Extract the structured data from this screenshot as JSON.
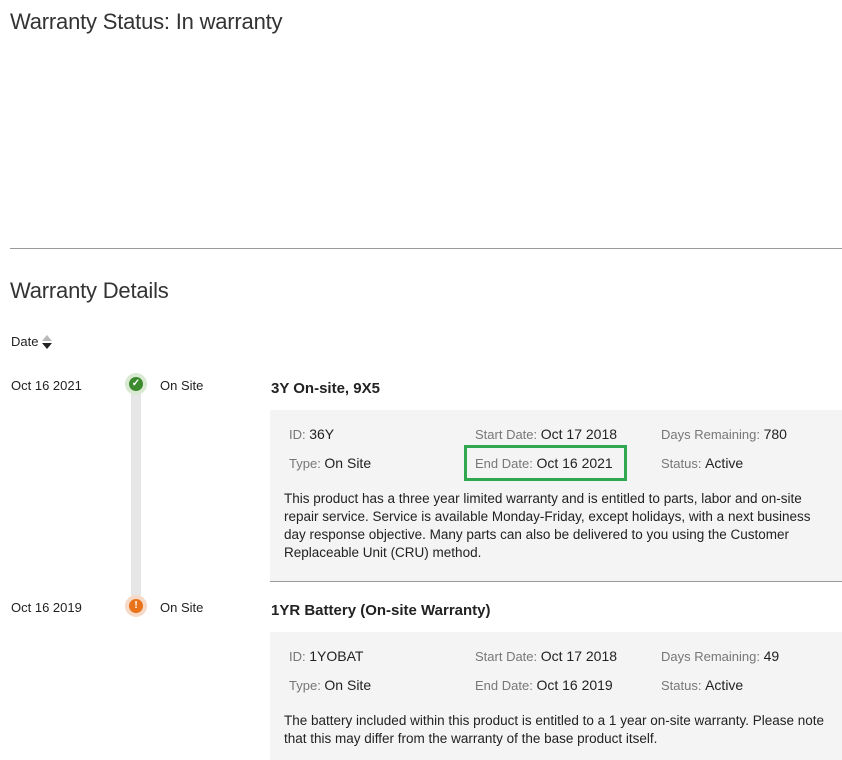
{
  "header": {
    "title": "Warranty Status: In warranty"
  },
  "details": {
    "title": "Warranty Details"
  },
  "sort": {
    "label": "Date"
  },
  "labels": {
    "id": "ID",
    "type": "Type",
    "start": "Start Date",
    "end": "End Date",
    "days": "Days Remaining",
    "status": "Status"
  },
  "entries": [
    {
      "date": "Oct 16 2021",
      "type_short": "On Site",
      "title": "3Y On-site, 9X5",
      "id": "36Y",
      "type": "On Site",
      "start_date": "Oct 17 2018",
      "end_date": "Oct 16 2021",
      "days_remaining": "780",
      "status": "Active",
      "description": "This product has a three year limited warranty and is entitled to parts, labor and on-site repair service. Service is available Monday-Friday, except holidays, with a next business day response objective. Many parts can also be delivered to you using the Customer Replaceable Unit (CRU) method."
    },
    {
      "date": "Oct 16 2019",
      "type_short": "On Site",
      "title": "1YR Battery (On-site Warranty)",
      "id": "1YOBAT",
      "type": "On Site",
      "start_date": "Oct 17 2018",
      "end_date": "Oct 16 2019",
      "days_remaining": "49",
      "status": "Active",
      "description": "The battery included within this product is entitled to a 1 year on-site warranty. Please note that this may differ from the warranty of the base product itself."
    }
  ],
  "icons": {
    "entry0": "check-circle-icon",
    "entry1": "exclamation-circle-icon",
    "sort": "sort-arrows-icon"
  },
  "colors": {
    "ok": "#3c8a2e",
    "warn": "#e8731a",
    "highlight": "#2fa84f"
  }
}
